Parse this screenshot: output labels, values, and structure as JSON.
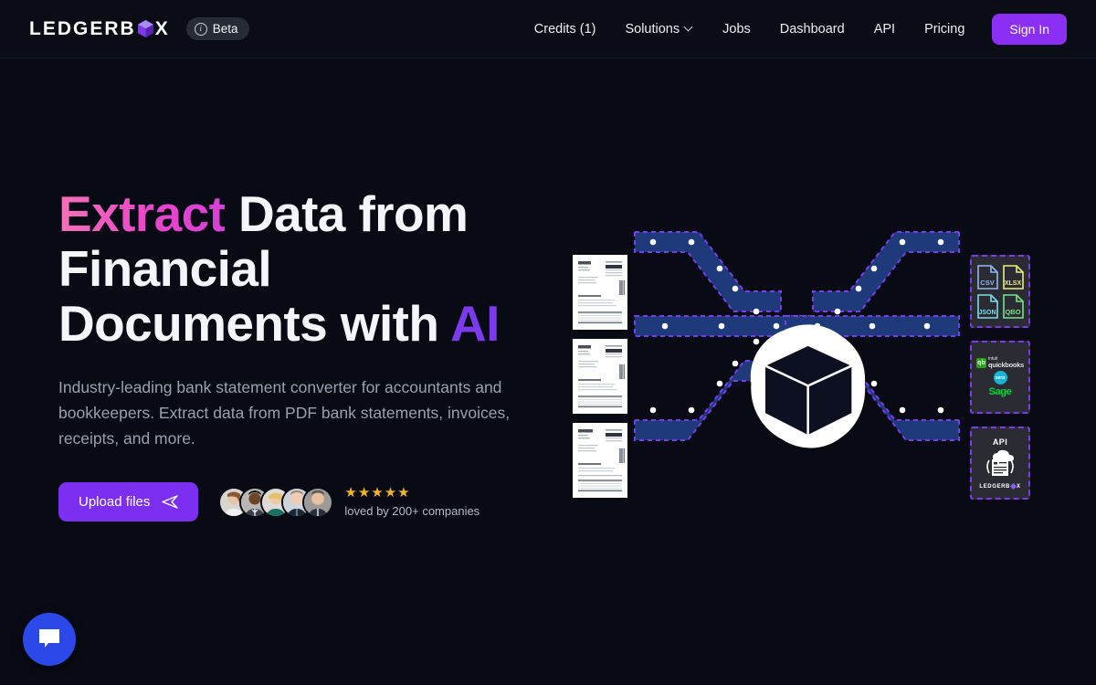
{
  "header": {
    "logo_text": "LEDGERB",
    "logo_text_tail": "X",
    "logo_icon": "cube-icon",
    "beta_label": "Beta",
    "beta_icon": "info-circle-icon",
    "nav": [
      {
        "label": "Credits (1)",
        "name": "credits"
      },
      {
        "label": "Solutions",
        "name": "solutions",
        "has_chevron": true
      },
      {
        "label": "Jobs",
        "name": "jobs"
      },
      {
        "label": "Dashboard",
        "name": "dashboard"
      },
      {
        "label": "API",
        "name": "api"
      },
      {
        "label": "Pricing",
        "name": "pricing"
      }
    ],
    "signin_label": "Sign In"
  },
  "hero": {
    "headline_part1": "Extract",
    "headline_part2": " Data from Financial Documents with ",
    "headline_part3": "AI",
    "subhead": "Industry-leading bank statement converter for accountants and bookkeepers. Extract data from PDF bank statements, invoices, receipts, and more.",
    "upload_label": "Upload files",
    "upload_icon": "paper-plane-icon",
    "stars": "★★★★★",
    "star_count": 5,
    "loved_text": "loved by 200+ companies",
    "avatar_count": 5
  },
  "illustration": {
    "center_icon": "3d-cube-blob-icon",
    "documents": [
      {
        "name": "document-thumbnail-1"
      },
      {
        "name": "document-thumbnail-2"
      },
      {
        "name": "document-thumbnail-3"
      }
    ],
    "output_cards": [
      {
        "name": "file-formats-card",
        "files": [
          {
            "label": "CSV",
            "color": "#93b9f0"
          },
          {
            "label": "XLSX",
            "color": "#e9ef7a"
          },
          {
            "label": "JSON",
            "color": "#7ddbe8"
          },
          {
            "label": "QBO",
            "color": "#78e58a"
          }
        ]
      },
      {
        "name": "accounting-integrations-card",
        "intuit": "intuit",
        "quickbooks": "quickbooks",
        "qb_badge": "qb",
        "xero": "xero",
        "sage": "Sage"
      },
      {
        "name": "api-card",
        "api_label": "API",
        "brand_left": "LEDGERB",
        "brand_right": "X"
      }
    ]
  },
  "chat": {
    "icon": "chat-bubble-icon",
    "color": "#2b49e8"
  },
  "colors": {
    "background": "#080b14",
    "header_bg": "#0a0d16",
    "accent_purple": "#7c3aed",
    "accent_pink": "#ec4bbe",
    "star_gold": "#f0b52b"
  }
}
